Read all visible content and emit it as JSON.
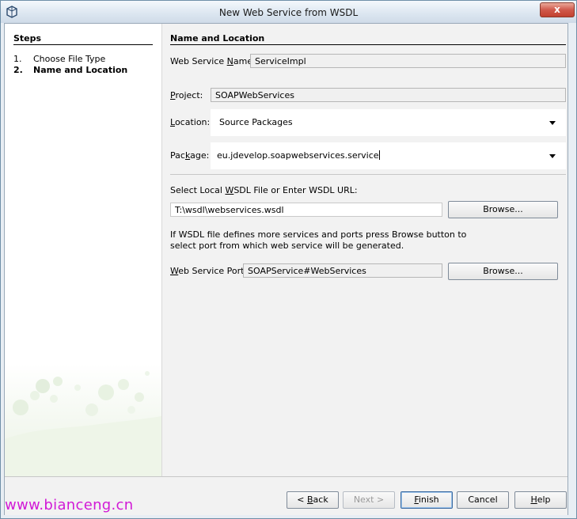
{
  "window": {
    "title": "New Web Service from WSDL",
    "close_glyph": "x"
  },
  "steps": {
    "heading": "Steps",
    "items": [
      {
        "num": "1.",
        "label": "Choose File Type",
        "active": false
      },
      {
        "num": "2.",
        "label": "Name and Location",
        "active": true
      }
    ]
  },
  "main": {
    "heading": "Name and Location",
    "service_name": {
      "label_pre": "Web Service ",
      "label_mn": "N",
      "label_post": "ame:",
      "value": "ServiceImpl"
    },
    "project": {
      "label_pre": "",
      "label_mn": "P",
      "label_post": "roject:",
      "value": "SOAPWebServices"
    },
    "location": {
      "label_pre": "",
      "label_mn": "L",
      "label_post": "ocation:",
      "value": "Source Packages"
    },
    "package": {
      "label_pre": "Pac",
      "label_mn": "k",
      "label_post": "age:",
      "value": "eu.jdevelop.soapwebservices.service"
    },
    "wsdl": {
      "label_pre": "Select Local ",
      "label_mn": "W",
      "label_post": "SDL File or Enter WSDL URL:",
      "value": "T:\\wsdl\\webservices.wsdl",
      "browse_label": "Browse..."
    },
    "note_line1": "If WSDL file defines more services and ports press Browse button to",
    "note_line2": "select port from which web service will be generated.",
    "port": {
      "label_pre": "",
      "label_mn": "W",
      "label_post": "eb Service Port:",
      "value": "SOAPService#WebServices",
      "browse_label": "Browse..."
    }
  },
  "footer": {
    "back": {
      "pre": "< ",
      "mn": "B",
      "post": "ack"
    },
    "next": {
      "label": "Next >"
    },
    "finish": {
      "pre": "",
      "mn": "F",
      "post": "inish"
    },
    "cancel": {
      "label": "Cancel"
    },
    "help": {
      "pre": "",
      "mn": "H",
      "post": "elp"
    }
  },
  "watermark": "www.bianceng.cn",
  "colors": {
    "accent": "#3b6aa0",
    "watermark": "#d11ad6",
    "close": "#c2412f"
  }
}
